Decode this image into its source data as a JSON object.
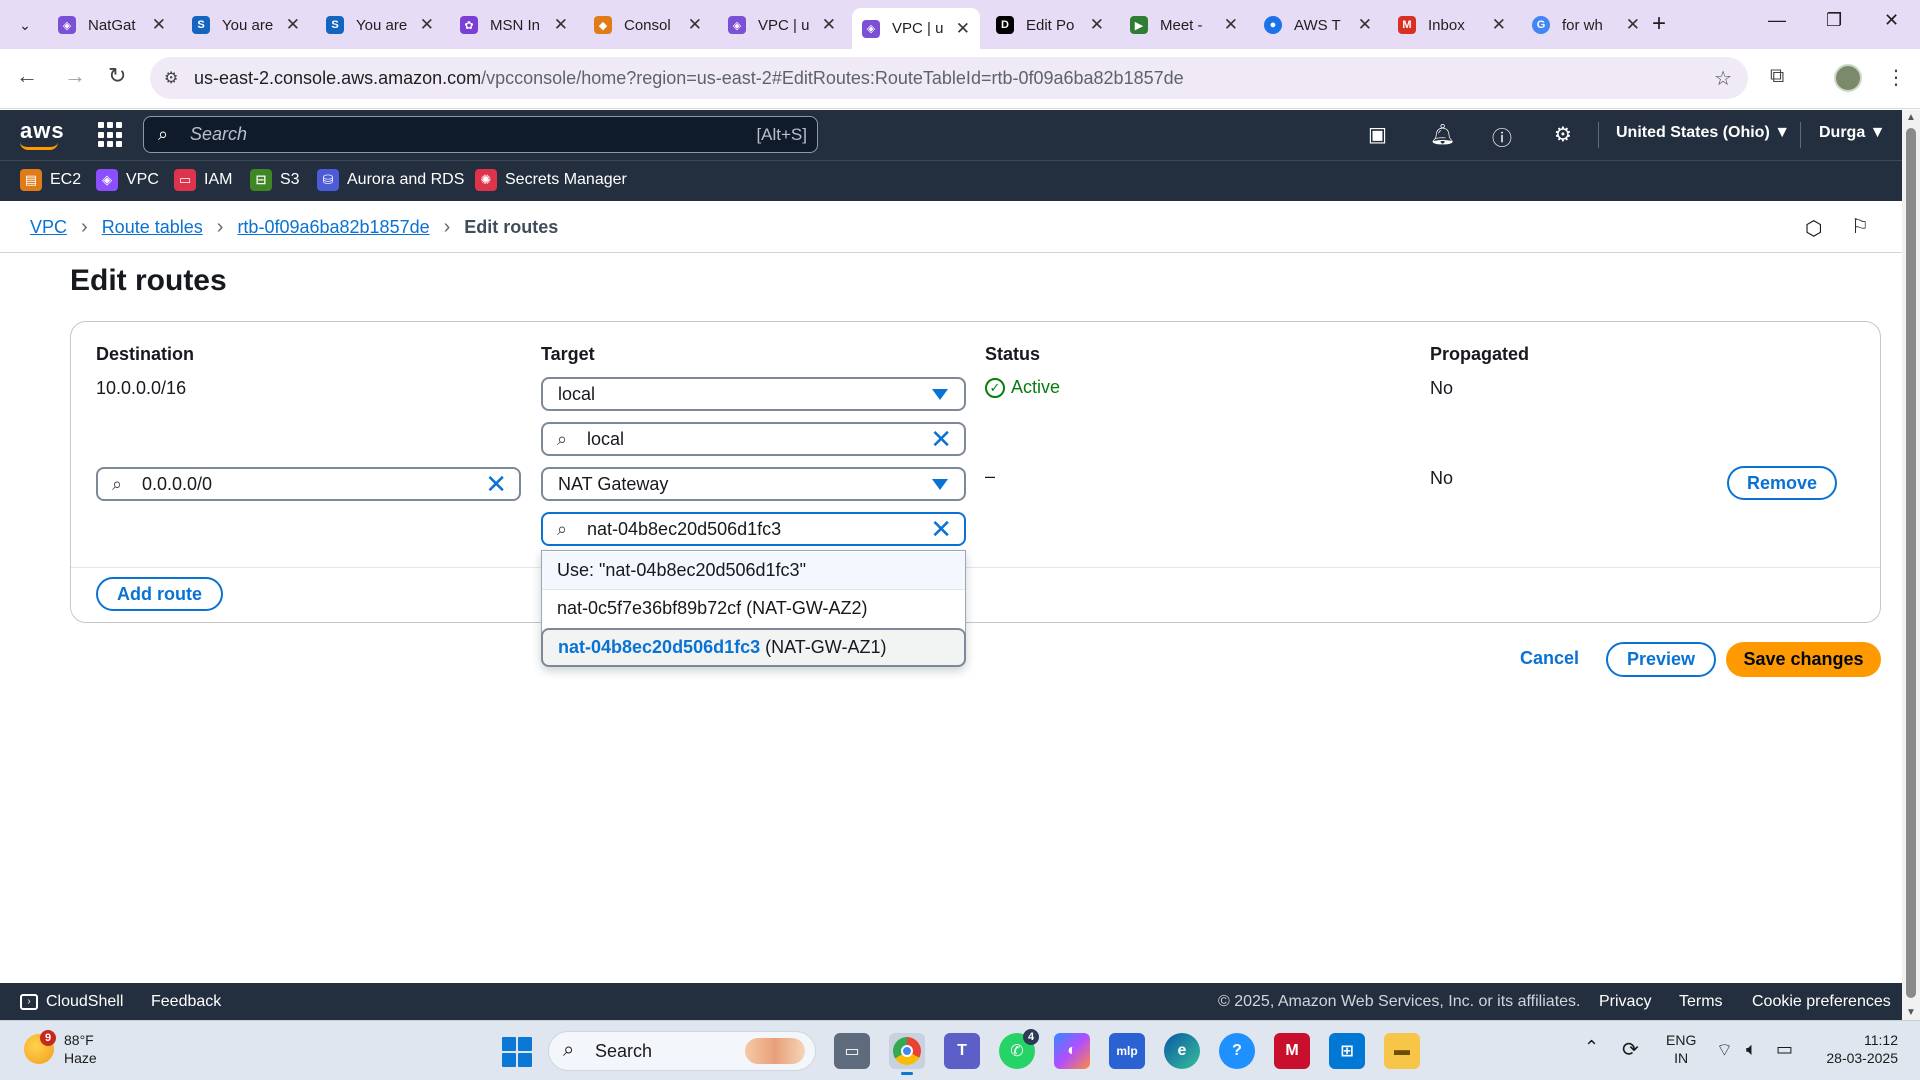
{
  "browser": {
    "tabs": [
      {
        "label": "NatGat",
        "favicon": "aws-vpc",
        "color": "#7b4fd6"
      },
      {
        "label": "You are",
        "favicon": "s",
        "color": "#1565c0"
      },
      {
        "label": "You are",
        "favicon": "s",
        "color": "#1565c0"
      },
      {
        "label": "MSN In",
        "favicon": "msn",
        "color": "#7b3fd6"
      },
      {
        "label": "Consol",
        "favicon": "aws-console",
        "color": "#e07b1a"
      },
      {
        "label": "VPC | u",
        "favicon": "aws-vpc",
        "color": "#7b4fd6"
      },
      {
        "label": "VPC | u",
        "favicon": "aws-vpc",
        "color": "#7b4fd6",
        "active": true
      },
      {
        "label": "Edit Po",
        "favicon": "dev",
        "color": "#000000"
      },
      {
        "label": "Meet -",
        "favicon": "meet",
        "color": "#2e7d32"
      },
      {
        "label": "AWS T",
        "favicon": "aws-t",
        "color": "#1a73e8"
      },
      {
        "label": "Inbox",
        "favicon": "gmail",
        "color": "#d93025"
      },
      {
        "label": "for wh",
        "favicon": "google",
        "color": "#4285f4"
      }
    ],
    "url_host": "us-east-2.console.aws.amazon.com",
    "url_rest": "/vpcconsole/home?region=us-east-2#EditRoutes:RouteTableId=rtb-0f09a6ba82b1857de"
  },
  "aws_header": {
    "logo": "aws",
    "search_placeholder": "Search",
    "search_shortcut": "[Alt+S]",
    "region": "United States (Ohio) ▼",
    "user": "Durga ▼"
  },
  "favorites": [
    {
      "label": "EC2",
      "color": "#e07b1a",
      "icon": "ec2-icon"
    },
    {
      "label": "VPC",
      "color": "#8c4fff",
      "icon": "vpc-icon"
    },
    {
      "label": "IAM",
      "color": "#dd344c",
      "icon": "iam-icon"
    },
    {
      "label": "S3",
      "color": "#3f8624",
      "icon": "s3-icon"
    },
    {
      "label": "Aurora and RDS",
      "color": "#4d5bd9",
      "icon": "rds-icon"
    },
    {
      "label": "Secrets Manager",
      "color": "#dd344c",
      "icon": "secrets-icon"
    }
  ],
  "breadcrumb": {
    "items": [
      "VPC",
      "Route tables",
      "rtb-0f09a6ba82b1857de"
    ],
    "current": "Edit routes"
  },
  "page": {
    "title": "Edit routes",
    "columns": {
      "destination": "Destination",
      "target": "Target",
      "status": "Status",
      "propagated": "Propagated"
    },
    "rows": [
      {
        "destination": "10.0.0.0/16",
        "target_select": "local",
        "target_search": "local",
        "status": "Active",
        "propagated": "No"
      },
      {
        "destination_search": "0.0.0.0/0",
        "target_select": "NAT Gateway",
        "target_search": "nat-04b8ec20d506d1fc3",
        "status": "–",
        "propagated": "No",
        "remove_label": "Remove"
      }
    ],
    "dropdown": {
      "use_option": "Use: \"nat-04b8ec20d506d1fc3\"",
      "options": [
        {
          "id": "nat-0c5f7e36bf89b72cf",
          "name": "(NAT-GW-AZ2)"
        },
        {
          "id": "nat-04b8ec20d506d1fc3",
          "name": "(NAT-GW-AZ1)"
        }
      ]
    },
    "add_route_label": "Add route",
    "cancel_label": "Cancel",
    "preview_label": "Preview",
    "save_label": "Save changes"
  },
  "footer": {
    "cloudshell": "CloudShell",
    "feedback": "Feedback",
    "copyright": "© 2025, Amazon Web Services, Inc. or its affiliates.",
    "privacy": "Privacy",
    "terms": "Terms",
    "cookie": "Cookie preferences"
  },
  "taskbar": {
    "weather_temp": "88°F",
    "weather_cond": "Haze",
    "weather_badge": "9",
    "search_label": "Search",
    "teams_badge": "4",
    "lang_line1": "ENG",
    "lang_line2": "IN",
    "time": "11:12",
    "date": "28-03-2025"
  }
}
